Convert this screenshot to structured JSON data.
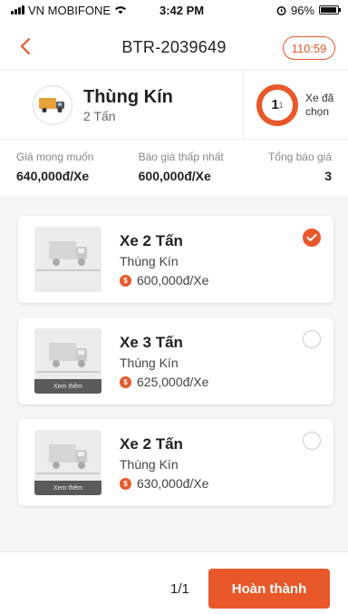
{
  "status_bar": {
    "carrier": "VN MOBIFONE",
    "time": "3:42 PM",
    "battery": "96%",
    "battery_level": 0.96
  },
  "header": {
    "title": "BTR-2039649",
    "timer": "110:59",
    "back_icon": "chevron-left-icon"
  },
  "vehicle": {
    "name": "Thùng Kín",
    "weight": "2 Tấn",
    "icon": "truck-icon",
    "selected_count": "1",
    "selected_total": "1",
    "selected_label": "Xe đã chọn"
  },
  "prices": {
    "expected_label": "Giá mong muốn",
    "expected_value": "640,000đ/Xe",
    "lowest_label": "Báo giá thấp nhất",
    "lowest_value": "600,000đ/Xe",
    "total_label": "Tổng báo giá",
    "total_value": "3"
  },
  "quotes": [
    {
      "title": "Xe 2 Tấn",
      "type": "Thùng Kín",
      "price": "600,000đ/Xe",
      "selected": true,
      "more_label": ""
    },
    {
      "title": "Xe 3 Tấn",
      "type": "Thùng Kín",
      "price": "625,000đ/Xe",
      "selected": false,
      "more_label": "Xem thêm"
    },
    {
      "title": "Xe 2 Tấn",
      "type": "Thùng Kín",
      "price": "630,000đ/Xe",
      "selected": false,
      "more_label": "Xem thêm"
    }
  ],
  "footer": {
    "pager": "1/1",
    "finish_label": "Hoàn thành"
  },
  "colors": {
    "accent": "#e8582a"
  }
}
